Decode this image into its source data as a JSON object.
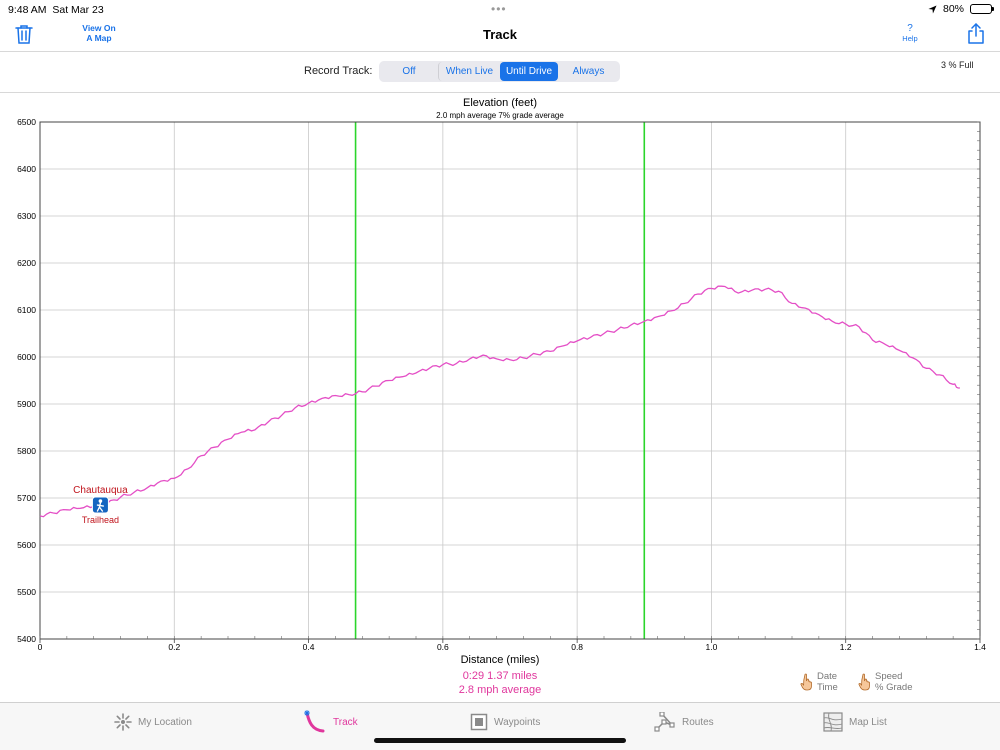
{
  "status": {
    "time": "9:48 AM",
    "date": "Sat Mar 23",
    "dots": "•••",
    "battery": "80%",
    "battery_level": 0.8
  },
  "nav": {
    "title": "Track",
    "view_on_map": "View On\nA Map",
    "help_q": "?",
    "help": "Help",
    "icons": {
      "trash": "trash-icon",
      "share": "share-icon"
    }
  },
  "record": {
    "label": "Record Track:",
    "options": [
      "Off",
      "When Live",
      "Until Drive",
      "Always"
    ],
    "selected": "Until Drive",
    "full": "3 % Full"
  },
  "colors": {
    "accent": "#1a73e8",
    "track": "#e44fc6",
    "marker": "#2bd52b",
    "poi": "#c0141c",
    "summary": "#e0379d"
  },
  "chart_data": {
    "type": "line",
    "title": "Elevation (feet)",
    "subtitle": "2.0 mph average  7% grade average",
    "xlabel": "Distance (miles)",
    "ylabel": "",
    "xlim": [
      0,
      1.4
    ],
    "ylim": [
      5400,
      6500
    ],
    "xticks": [
      "0",
      "0.2",
      "0.4",
      "0.6",
      "0.8",
      "1.0",
      "1.2",
      "1.4"
    ],
    "yticks": [
      "6500",
      "6400",
      "6300",
      "6200",
      "6100",
      "6000",
      "5900",
      "5800",
      "5700",
      "5600",
      "5500",
      "5400"
    ],
    "grid": true,
    "markers_x": [
      0.47,
      0.9
    ],
    "series": [
      {
        "x": [
          0,
          0.02,
          0.04,
          0.06,
          0.08,
          0.1,
          0.12,
          0.14,
          0.16,
          0.18,
          0.2,
          0.22,
          0.24,
          0.26,
          0.28,
          0.3,
          0.32,
          0.34,
          0.36,
          0.38,
          0.4,
          0.42,
          0.44,
          0.46,
          0.48,
          0.5,
          0.52,
          0.54,
          0.56,
          0.58,
          0.6,
          0.62,
          0.64,
          0.66,
          0.68,
          0.7,
          0.72,
          0.74,
          0.76,
          0.78,
          0.8,
          0.82,
          0.84,
          0.86,
          0.88,
          0.9,
          0.92,
          0.94,
          0.96,
          0.98,
          1.0,
          1.02,
          1.04,
          1.06,
          1.08,
          1.1,
          1.12,
          1.14,
          1.16,
          1.18,
          1.2,
          1.22,
          1.24,
          1.26,
          1.28,
          1.3,
          1.32,
          1.34,
          1.36,
          1.37
        ],
        "y": [
          5662,
          5668,
          5675,
          5678,
          5682,
          5688,
          5702,
          5712,
          5722,
          5736,
          5742,
          5762,
          5790,
          5808,
          5825,
          5840,
          5845,
          5862,
          5876,
          5892,
          5902,
          5912,
          5918,
          5920,
          5926,
          5938,
          5950,
          5958,
          5966,
          5976,
          5984,
          5986,
          5996,
          6004,
          5996,
          5994,
          5998,
          6006,
          6012,
          6024,
          6034,
          6042,
          6050,
          6058,
          6068,
          6076,
          6086,
          6098,
          6114,
          6134,
          6146,
          6150,
          6136,
          6142,
          6144,
          6140,
          6114,
          6104,
          6090,
          6076,
          6070,
          6064,
          6036,
          6026,
          6014,
          5998,
          5976,
          5962,
          5942,
          5934
        ]
      }
    ],
    "annotations": [
      {
        "name": "Chautauqua",
        "sub": "Trailhead",
        "x": 0.09,
        "y": 5685
      }
    ],
    "summary": {
      "line1": "0:29   1.37 miles",
      "line2": "2.8 mph average"
    }
  },
  "legend": {
    "date_time": "Date\nTime",
    "speed_grade": "Speed\n% Grade"
  },
  "tabs": [
    {
      "label": "My Location",
      "icon": "sun-icon",
      "active": false
    },
    {
      "label": "Track",
      "icon": "track-icon",
      "active": true
    },
    {
      "label": "Waypoints",
      "icon": "waypoint-icon",
      "active": false
    },
    {
      "label": "Routes",
      "icon": "route-icon",
      "active": false
    },
    {
      "label": "Map List",
      "icon": "map-list-icon",
      "active": false
    }
  ]
}
